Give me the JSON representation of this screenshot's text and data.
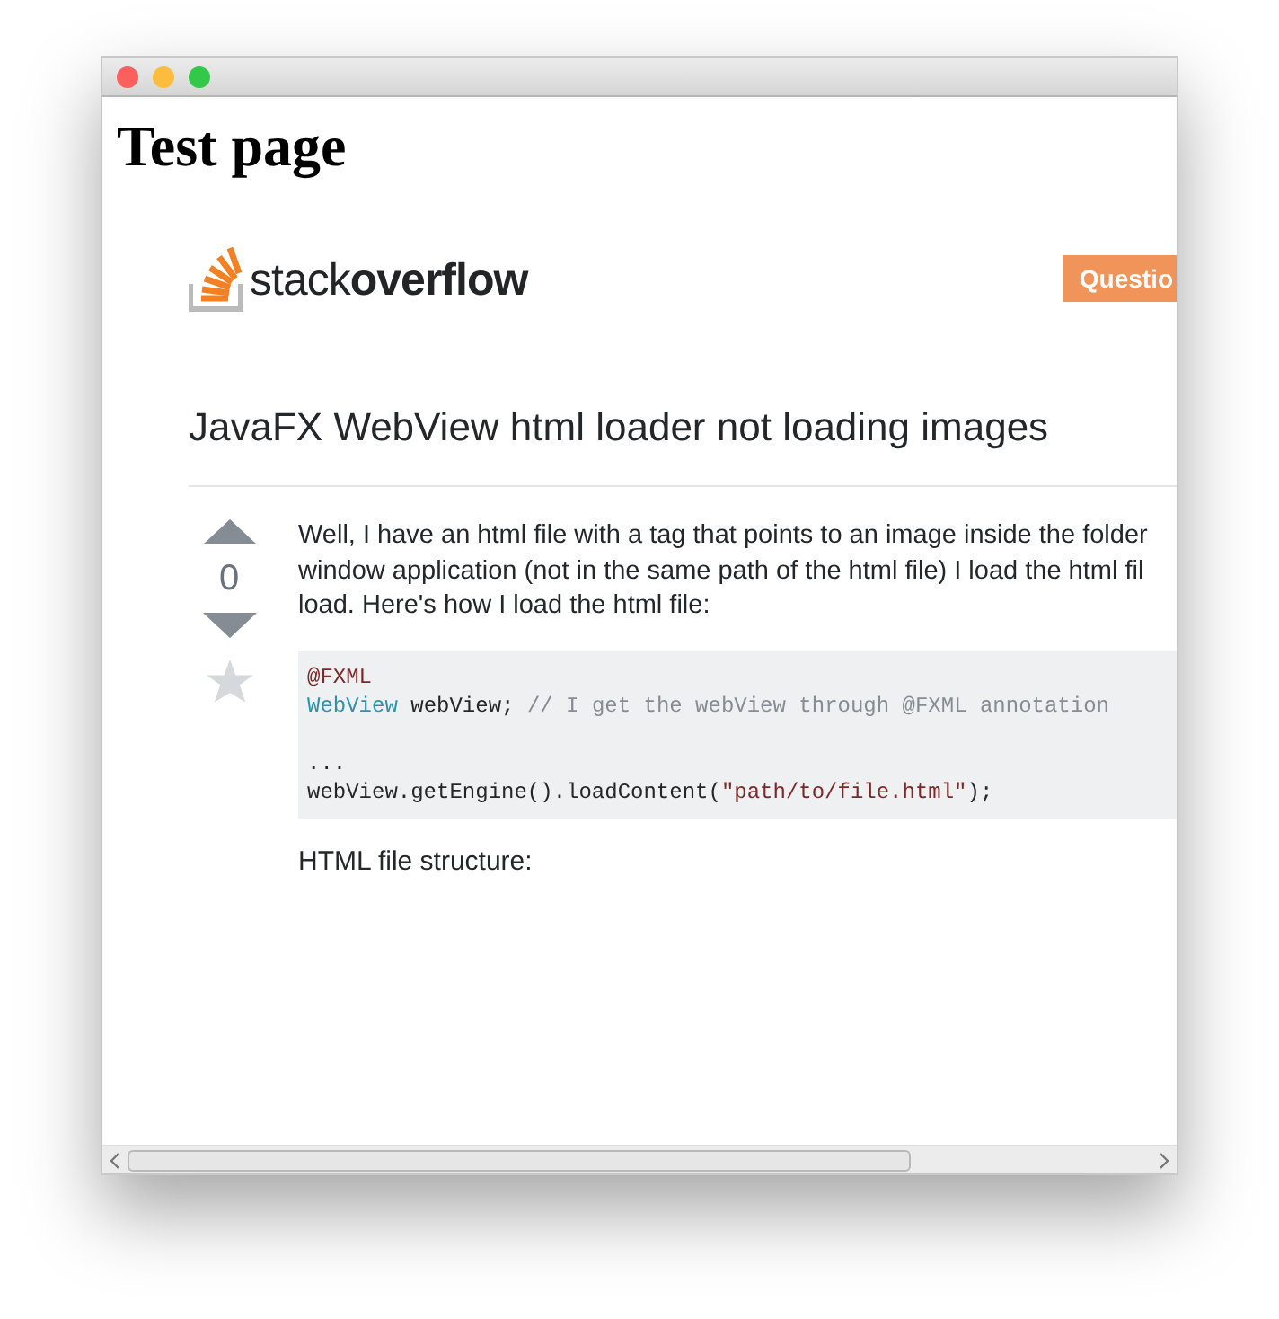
{
  "page": {
    "heading": "Test page"
  },
  "screenshot": {
    "logo": "stack**overflow**",
    "header_button": "Questio",
    "question_title": "JavaFX WebView html loader not loading images",
    "votes": "0",
    "body_lines": [
      "Well, I have an html file with a tag that points to an image inside the folder",
      "window application (not in the same path of the html file) I load the html fil",
      "load. Here's how I load the html file:"
    ],
    "code_lines": [
      {
        "kind": "code",
        "segments": [
          {
            "kind": "annotation",
            "text": "@FXML"
          }
        ]
      },
      {
        "kind": "code",
        "segments": [
          {
            "kind": "type",
            "text": "WebView"
          },
          {
            "kind": "plain",
            "text": " webView; "
          },
          {
            "kind": "comment",
            "text": "// I get the webView through @FXML annotation"
          }
        ]
      },
      {
        "kind": "blank"
      },
      {
        "kind": "code",
        "segments": [
          {
            "kind": "plain",
            "text": "..."
          }
        ]
      },
      {
        "kind": "code",
        "segments": [
          {
            "kind": "plain",
            "text": "webView.getEngine().loadContent("
          },
          {
            "kind": "string",
            "text": "\"path/to/file.html\""
          },
          {
            "kind": "plain",
            "text": ");"
          }
        ]
      }
    ],
    "after_code": "HTML file structure:"
  }
}
